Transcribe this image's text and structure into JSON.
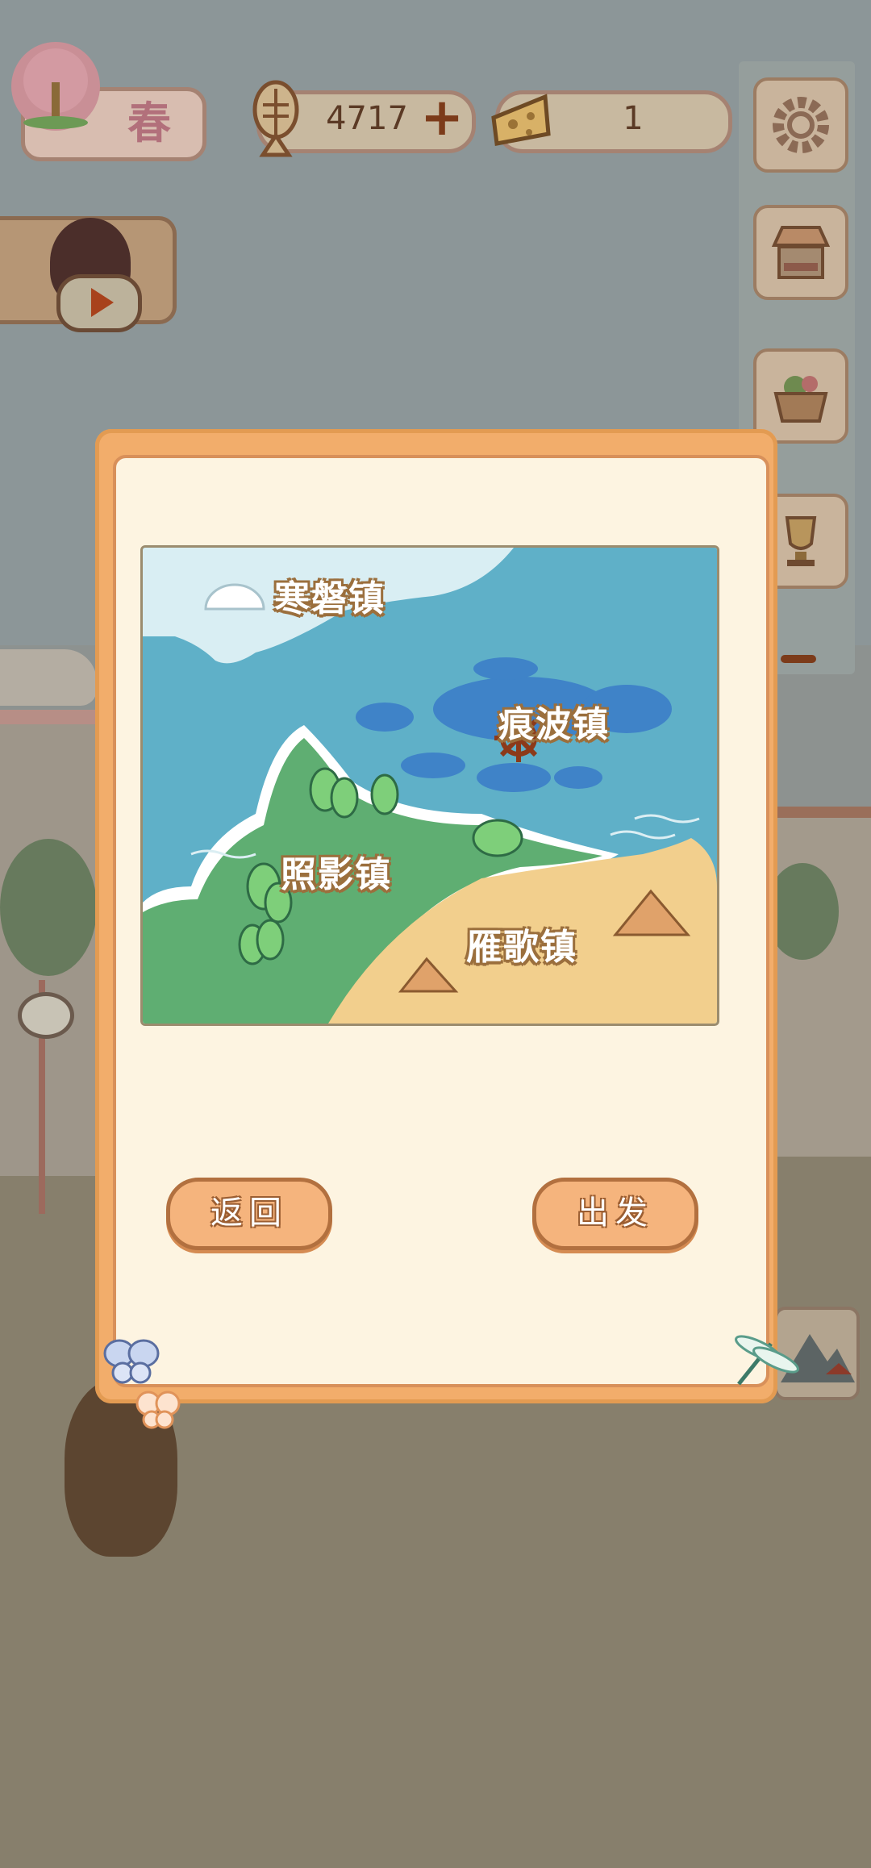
{
  "hud": {
    "season_label": "春",
    "fish_currency": "4717",
    "fish_add_symbol": "+",
    "cheese_currency": "1"
  },
  "side_menu": {
    "items": [
      {
        "icon": "gear-icon"
      },
      {
        "icon": "shop-stall-icon"
      },
      {
        "icon": "basket-icon"
      },
      {
        "icon": "trophy-icon"
      }
    ]
  },
  "dialog": {
    "map": {
      "towns": {
        "north": "寒磐镇",
        "east": "痕波镇",
        "west": "照影镇",
        "south": "雁歌镇"
      }
    },
    "back_button": "返回",
    "depart_button": "出发"
  },
  "colors": {
    "dialog_frame": "#f2ad6b",
    "dialog_bg": "#fdf4e1",
    "button_fill": "#f5b47d",
    "sea": "#5fb0c8",
    "land_green": "#5fae72",
    "desert": "#f2cf8d"
  }
}
